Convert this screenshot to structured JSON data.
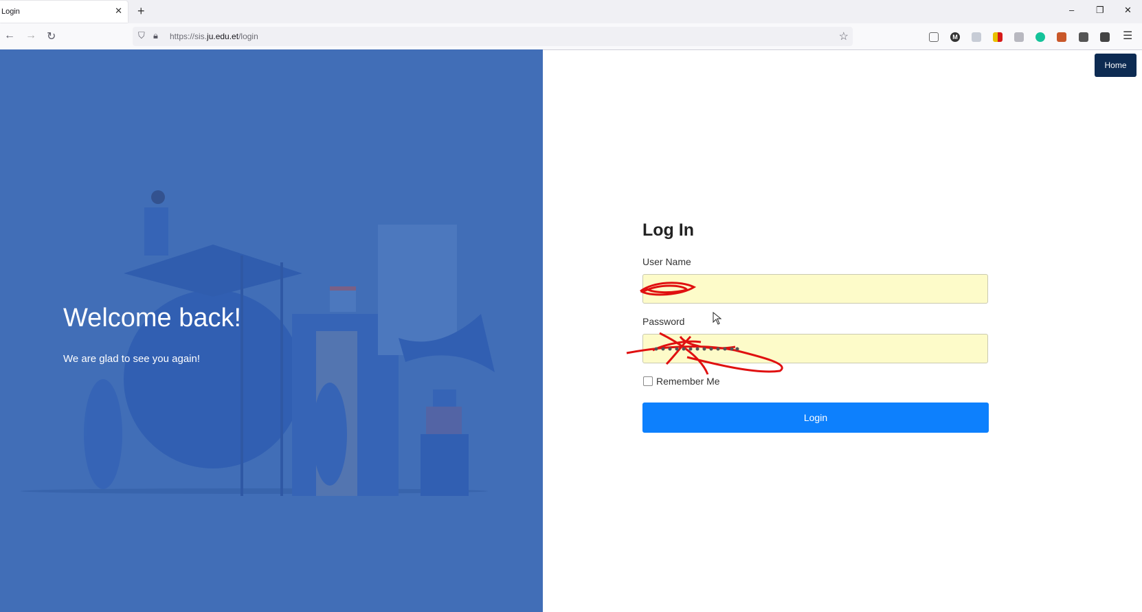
{
  "browser": {
    "tab_title": "Login",
    "tab_close": "✕",
    "new_tab": "+",
    "url_scheme": "https://sis.",
    "url_domain": "ju.edu.et",
    "url_path": "/login",
    "window_minimize": "–",
    "window_restore": "❐",
    "window_close": "✕",
    "extension_m_label": "M"
  },
  "hero": {
    "heading": "Welcome back!",
    "subtext": "We are glad to see you again!"
  },
  "nav": {
    "home_label": "Home"
  },
  "form": {
    "title": "Log In",
    "username_label": "User Name",
    "password_label": "Password",
    "remember_label": "Remember Me",
    "submit_label": "Login"
  },
  "colors": {
    "hero_bg": "#416eb7",
    "primary": "#0d80fd",
    "home_bg": "#0d2b52",
    "autofill": "#fdfbc9"
  }
}
